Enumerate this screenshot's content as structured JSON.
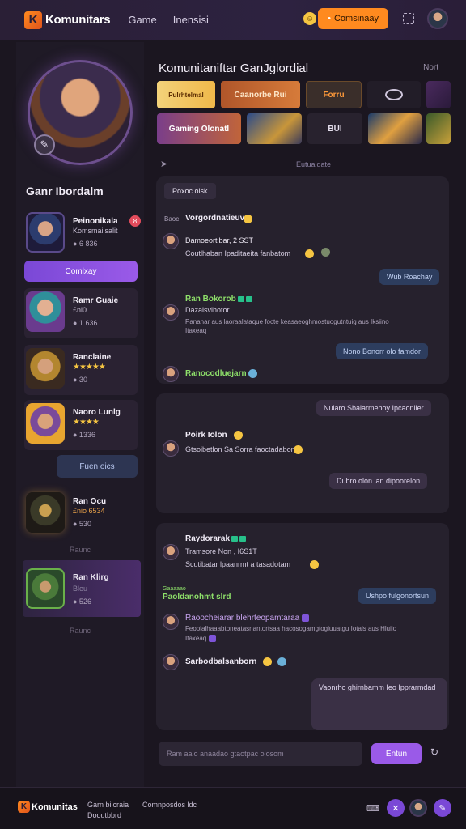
{
  "app": {
    "name": "Komunitars"
  },
  "nav": {
    "links": [
      "Game",
      "Inensisi"
    ]
  },
  "header": {
    "community_btn": "Comsinaay"
  },
  "sidebar": {
    "title": "Ganr Ibordalm",
    "community_btn": "Comlxay",
    "friends_btn": "Fuen oics",
    "label_1": "Raunc",
    "label_2": "Raunc",
    "friends": [
      {
        "name": "Peinonikala",
        "sub": "Komsmailsalit",
        "meta": "● 6 836",
        "badge": "8"
      },
      {
        "name": "Ramr Guaie",
        "sub": "£ni0",
        "meta": "● 1 636"
      },
      {
        "name": "Ranclaine",
        "stars": "★★★★★",
        "meta": "● 30"
      },
      {
        "name": "Naoro Lunlg",
        "stars": "★★★★",
        "meta": "● 1336"
      },
      {
        "name": "Ran Ocu",
        "sub": "£nio 6534",
        "meta": "● 530"
      },
      {
        "name": "Ran Klirg",
        "sub": "Bleu",
        "meta": "● 526"
      }
    ]
  },
  "main": {
    "title": "Komunitaniftar GanJglordial",
    "more": "Nort",
    "section_label": "Eutualdate",
    "tiles": [
      "Pulrhtelmal",
      "Caanorbe Rui",
      "Forru",
      "Gaming Olonatl",
      "BUI"
    ]
  },
  "chat": {
    "panel1": {
      "tag": "Poxoc olsk",
      "row1_name": "Vorgordnatieuv",
      "row1_prefix": "Baoc",
      "row2_name": "Damoeortibar, 2 SST",
      "row2_text": "Coutlhaban Ipaditaeita fanbatom",
      "bubble1": "Wub Roachay",
      "row3_name": "Ran Bokorob",
      "row3_sub": "Dazaisvihotor",
      "row3_text1": "Pananar aus laoraalataque focte keasaeoghmostuogutntuig aus Iksiino",
      "row3_text2": "Itaxeaq",
      "bubble2": "Nono Bonorr olo famdor",
      "row4_name": "Ranocodluejarn"
    },
    "panel2": {
      "bubble1": "Nularo Sbalarmehoy Ipcaonlier",
      "row1_name": "Poirk Iolon",
      "row1_text": "Gtsoibetlon Sa Sorra faoctadabom",
      "bubble2": "Dubro olon lan dipoorelon"
    },
    "panel3": {
      "row1_name": "Raydorarak",
      "row1_sub": "Tramsore Non , I6S1T",
      "row1_text": "Scutibatar lpaanrmt a tasadotam",
      "bubble1": "Ushpo fulgonortsun",
      "row2_name": "Paoldanohmt slrd",
      "row2_prefix": "Gaaaaao",
      "row3_name": "Raoocheiarar blehrteopamtaraa",
      "row3_text1": "Feoplalhaaabtoneatasnantortsaa hacosogamgtogluuatgu Iotals aus Hluiio",
      "row3_text2": "Itaxeaq",
      "row4_name": "Sarbodbalsanborn",
      "bubble2": "Vaonrho ghirnbamm Ieo Ipprarmdad"
    },
    "input_placeholder": "Ram aalo anaadao gtaotpac olosom",
    "send_btn": "Entun"
  },
  "footer": {
    "brand": "Komunitas",
    "link1_line1": "Garn bilcraia",
    "link1_line2": "Dooutbbrd",
    "link2": "Comnposdos ldc"
  },
  "colors": {
    "accent": "#9a5ae8",
    "orange": "#ff8a1f",
    "bg": "#1b1620"
  }
}
